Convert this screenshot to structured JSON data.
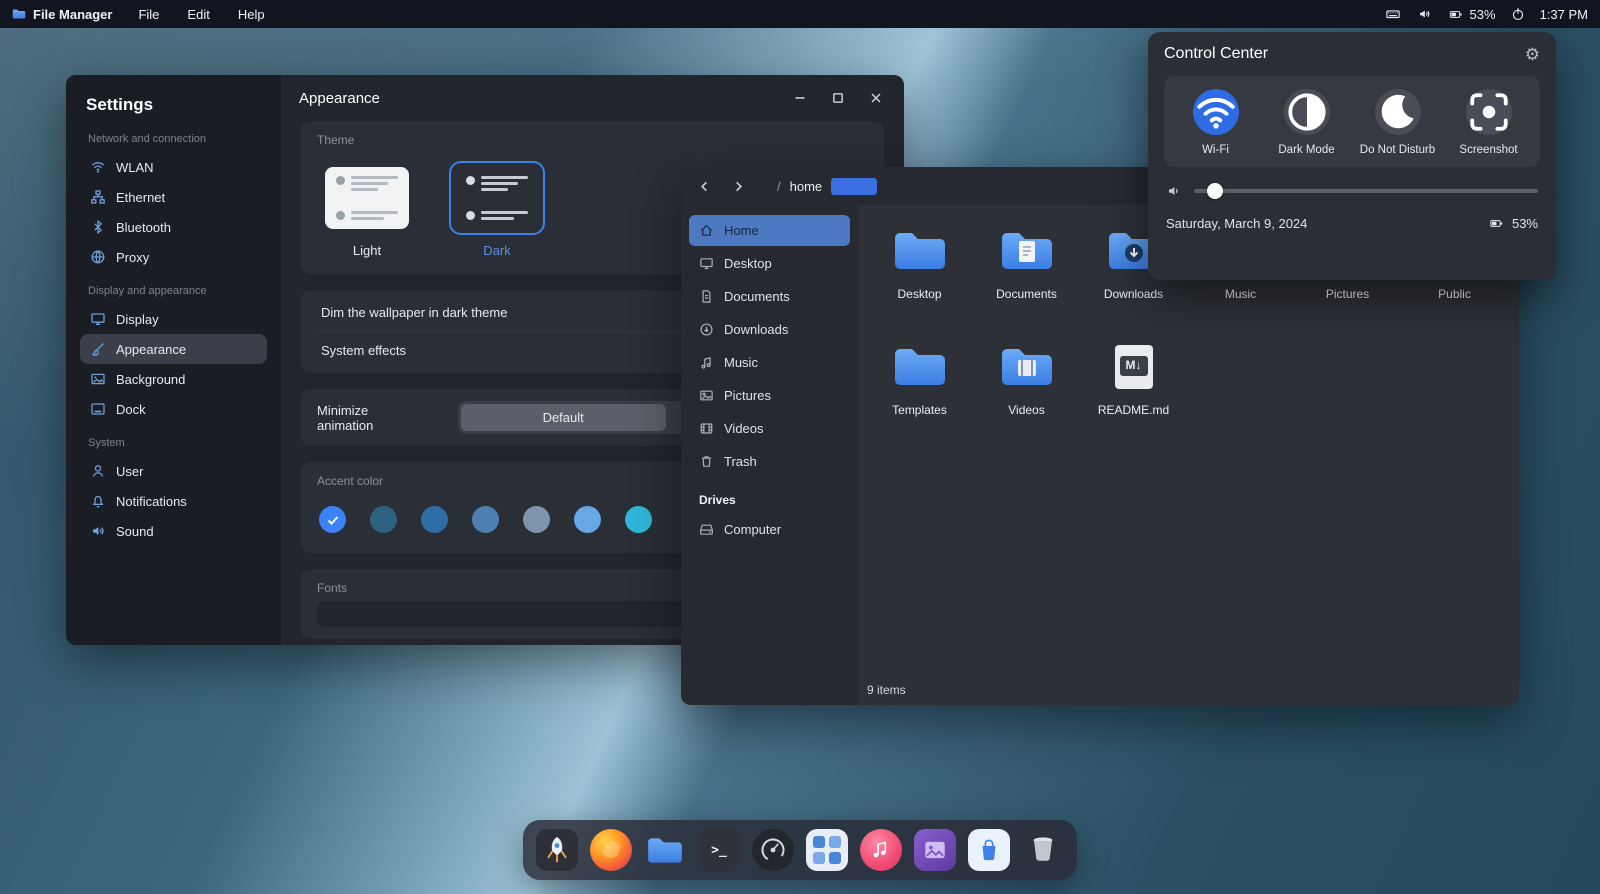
{
  "menubar": {
    "app_name": "File Manager",
    "menus": [
      {
        "label": "File"
      },
      {
        "label": "Edit"
      },
      {
        "label": "Help"
      }
    ],
    "battery_percent": "53%",
    "time": "1:37 PM"
  },
  "settings": {
    "title": "Settings",
    "page_title": "Appearance",
    "sidebar_sections": [
      {
        "label": "Network and connection",
        "items": [
          {
            "label": "WLAN"
          },
          {
            "label": "Ethernet"
          },
          {
            "label": "Bluetooth"
          },
          {
            "label": "Proxy"
          }
        ]
      },
      {
        "label": "Display and appearance",
        "items": [
          {
            "label": "Display"
          },
          {
            "label": "Appearance"
          },
          {
            "label": "Background"
          },
          {
            "label": "Dock"
          }
        ]
      },
      {
        "label": "System",
        "items": [
          {
            "label": "User"
          },
          {
            "label": "Notifications"
          },
          {
            "label": "Sound"
          }
        ]
      }
    ],
    "appearance": {
      "theme_label": "Theme",
      "light_label": "Light",
      "dark_label": "Dark",
      "dim_wallpaper_label": "Dim the wallpaper in dark theme",
      "system_effects_label": "System effects",
      "minimize_animation_label": "Minimize animation",
      "minimize_animation_value": "Default",
      "accent_color_label": "Accent color",
      "accent_colors": [
        "#3b82f6",
        "#2e6080",
        "#2e6da6",
        "#4d80b0",
        "#7e95ad",
        "#67a7e6",
        "#2fb6da"
      ],
      "fonts_label": "Fonts"
    }
  },
  "file_manager": {
    "path_root": "/",
    "path_segment": "home",
    "sidebar_items": [
      {
        "label": "Home"
      },
      {
        "label": "Desktop"
      },
      {
        "label": "Documents"
      },
      {
        "label": "Downloads"
      },
      {
        "label": "Music"
      },
      {
        "label": "Pictures"
      },
      {
        "label": "Videos"
      },
      {
        "label": "Trash"
      }
    ],
    "drives_label": "Drives",
    "drives": [
      {
        "label": "Computer"
      }
    ],
    "files": [
      {
        "name": "Desktop",
        "kind": "folder"
      },
      {
        "name": "Documents",
        "kind": "folder-documents"
      },
      {
        "name": "Downloads",
        "kind": "folder-downloads"
      },
      {
        "name": "Music",
        "kind": "folder"
      },
      {
        "name": "Pictures",
        "kind": "folder"
      },
      {
        "name": "Public",
        "kind": "folder"
      },
      {
        "name": "Templates",
        "kind": "folder"
      },
      {
        "name": "Videos",
        "kind": "folder-videos"
      },
      {
        "name": "README.md",
        "kind": "markdown"
      }
    ],
    "readme_glyph": "M↓",
    "status": "9 items"
  },
  "control_center": {
    "title": "Control Center",
    "tiles": [
      {
        "label": "Wi-Fi"
      },
      {
        "label": "Dark Mode"
      },
      {
        "label": "Do Not Disturb"
      },
      {
        "label": "Screenshot"
      }
    ],
    "volume_percent": 6,
    "date": "Saturday, March 9, 2024",
    "battery_percent": "53%"
  },
  "dock": {
    "terminal_glyph": ">_",
    "apps": [
      {
        "name": "launcher"
      },
      {
        "name": "firefox"
      },
      {
        "name": "file-manager"
      },
      {
        "name": "terminal"
      },
      {
        "name": "system-monitor"
      },
      {
        "name": "calculator"
      },
      {
        "name": "music"
      },
      {
        "name": "image-viewer"
      },
      {
        "name": "app-store"
      },
      {
        "name": "trash"
      }
    ]
  }
}
